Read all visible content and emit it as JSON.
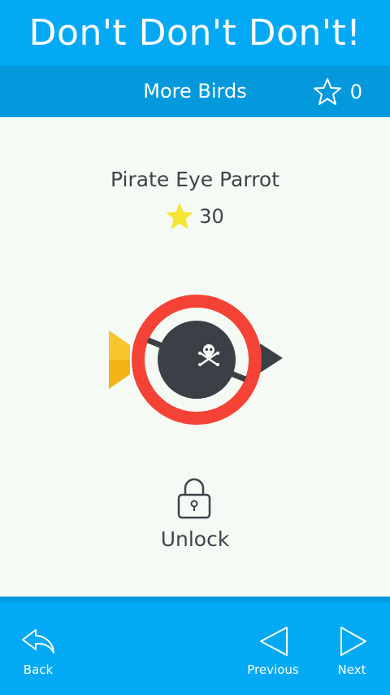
{
  "header": {
    "title": "Don't Don't Don't!"
  },
  "subheader": {
    "title": "More Birds",
    "star_icon": "star-outline-icon",
    "stars": "0"
  },
  "bird": {
    "name": "Pirate Eye Parrot",
    "price_icon": "star-icon",
    "price": "30"
  },
  "lock": {
    "icon": "lock-icon",
    "label": "Unlock"
  },
  "nav": {
    "back_label": "Back",
    "previous_label": "Previous",
    "next_label": "Next"
  },
  "colors": {
    "primary": "#03a9f4",
    "primary_dark": "#0499dc",
    "ring": "#f44336",
    "bird_body": "#3b4046",
    "beak": "#f2b417",
    "star": "#f5e532"
  }
}
